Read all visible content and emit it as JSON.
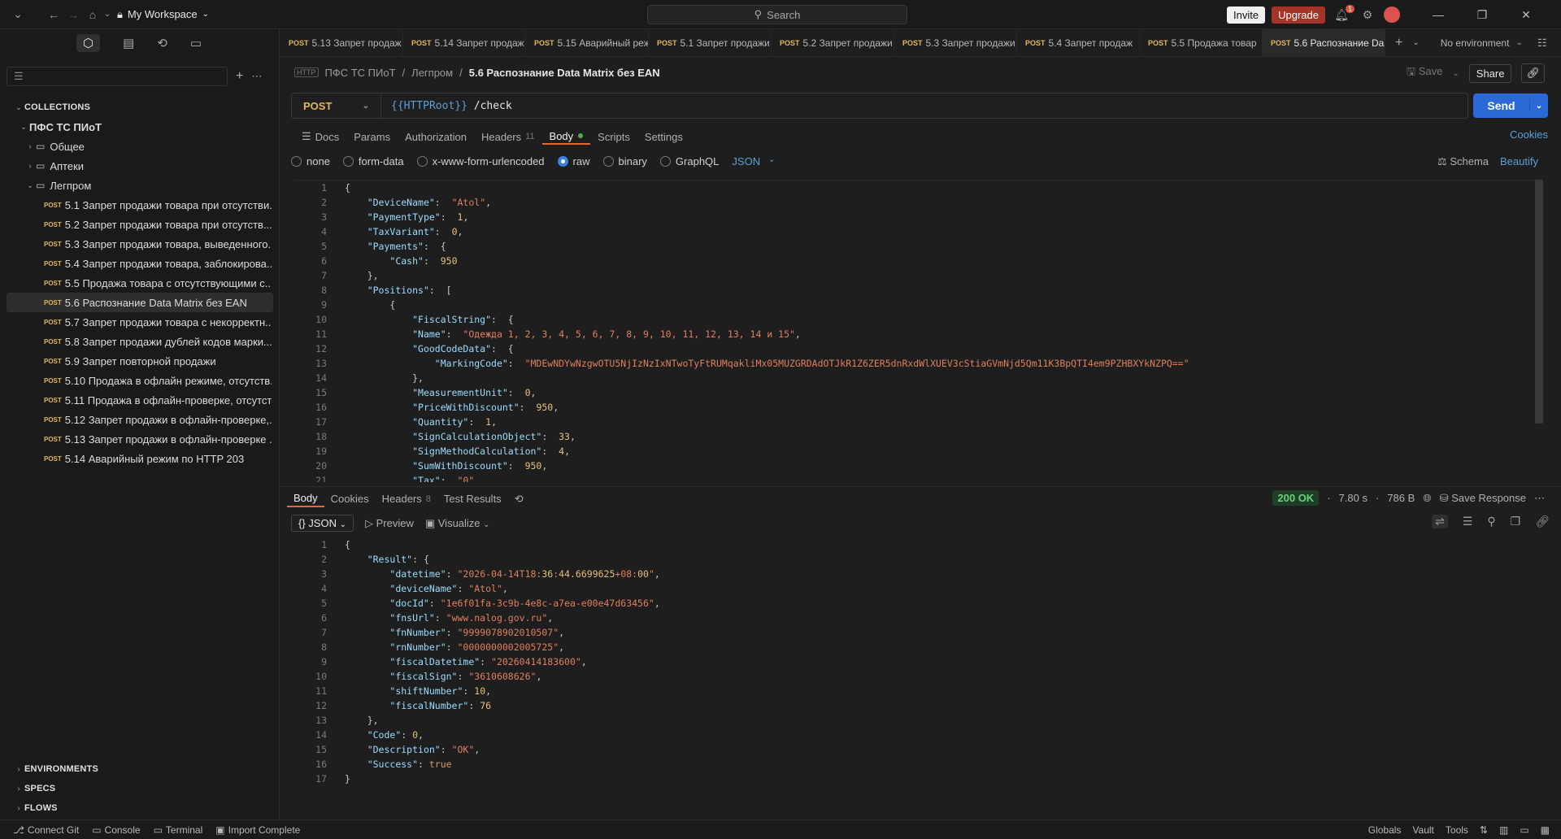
{
  "titlebar": {
    "workspace": "My Workspace",
    "search": "Search",
    "invite": "Invite",
    "upgrade": "Upgrade",
    "notif_count": "1"
  },
  "sidebar": {
    "collections_label": "COLLECTIONS",
    "root": "ПФС ТС ПИоТ",
    "folders": [
      "Общее",
      "Аптеки",
      "Легпром"
    ],
    "items": [
      "5.1 Запрет продажи товара при отсутстви...",
      "5.2 Запрет продажи товара при отсутств...",
      "5.3 Запрет продажи товара, выведенного...",
      "5.4 Запрет продажи товара, заблокирова...",
      "5.5 Продажа товара с отсутствующими с...",
      "5.6 Распознание Data Matrix без EAN",
      "5.7 Запрет продажи товара с некорректн...",
      "5.8 Запрет продажи дублей кодов марки...",
      "5.9 Запрет повторной продажи",
      "5.10 Продажа в офлайн режиме, отсутств...",
      "5.11 Продажа в офлайн-проверке, отсутст...",
      "5.12 Запрет продажи в офлайн-проверке,...",
      "5.13 Запрет продажи в офлайн-проверке ...",
      "5.14 Аварийный режим по HTTP 203"
    ],
    "post_tag": "POST",
    "environments": "ENVIRONMENTS",
    "specs": "SPECS",
    "flows": "FLOWS"
  },
  "tabs": [
    "5.13 Запрет продаж",
    "5.14 Запрет продаж",
    "5.15 Аварийный реж",
    "5.1 Запрет продажи",
    "5.2 Запрет продажи",
    "5.3 Запрет продажи",
    "5.4 Запрет продаж",
    "5.5 Продажа товар",
    "5.6 Распознание Da"
  ],
  "env": "No environment",
  "breadcrumb": {
    "root": "ПФС ТС ПИоТ",
    "folder": "Легпром",
    "current": "5.6 Распознание Data Matrix без EAN"
  },
  "save": "Save",
  "share": "Share",
  "request": {
    "method": "POST",
    "url_var": "{{HTTPRoot}}",
    "url_path": " /check",
    "send": "Send"
  },
  "reqtabs": {
    "docs": "Docs",
    "params": "Params",
    "auth": "Authorization",
    "headers": "Headers",
    "headers_count": "11",
    "body": "Body",
    "scripts": "Scripts",
    "settings": "Settings",
    "cookies": "Cookies"
  },
  "bodyopts": {
    "none": "none",
    "form": "form-data",
    "urlenc": "x-www-form-urlencoded",
    "raw": "raw",
    "binary": "binary",
    "graphql": "GraphQL",
    "json": "JSON",
    "schema": "Schema",
    "beautify": "Beautify"
  },
  "request_body": [
    "{",
    "    \"DeviceName\":  \"Atol\",",
    "    \"PaymentType\":  1,",
    "    \"TaxVariant\":  0,",
    "    \"Payments\":  {",
    "        \"Cash\":  950",
    "    },",
    "    \"Positions\":  [",
    "        {",
    "            \"FiscalString\":  {",
    "            \"Name\":  \"Одежда 1, 2, 3, 4, 5, 6, 7, 8, 9, 10, 11, 12, 13, 14 и 15\",",
    "            \"GoodCodeData\":  {",
    "                \"MarkingCode\":  \"MDEwNDYwNzgwOTU5NjIzNzIxNTwoTyFtRUMqakliMx05MUZGRDAdOTJkR1Z6ZER5dnRxdWlXUEV3cStiaGVmNjd5Qm11K3BpQTI4em9PZHBXYkNZPQ==\"",
    "            },",
    "            \"MeasurementUnit\":  0,",
    "            \"PriceWithDiscount\":  950,",
    "            \"Quantity\":  1,",
    "            \"SignCalculationObject\":  33,",
    "            \"SignMethodCalculation\":  4,",
    "            \"SumWithDiscount\":  950,",
    "            \"Tax\":  \"0\""
  ],
  "response": {
    "tabs": {
      "body": "Body",
      "cookies": "Cookies",
      "headers": "Headers",
      "headers_count": "8",
      "tests": "Test Results"
    },
    "status": "200 OK",
    "time": "7.80 s",
    "size": "786 B",
    "save": "Save Response",
    "format": "JSON",
    "preview": "Preview",
    "visualize": "Visualize",
    "body": [
      "{",
      "    \"Result\": {",
      "        \"datetime\": \"2026-04-14T18:36:44.6699625+08:00\",",
      "        \"deviceName\": \"Atol\",",
      "        \"docId\": \"1e6f01fa-3c9b-4e8c-a7ea-e00e47d63456\",",
      "        \"fnsUrl\": \"www.nalog.gov.ru\",",
      "        \"fnNumber\": \"9999078902010507\",",
      "        \"rnNumber\": \"0000000002005725\",",
      "        \"fiscalDatetime\": \"20260414183600\",",
      "        \"fiscalSign\": \"3610608626\",",
      "        \"shiftNumber\": 10,",
      "        \"fiscalNumber\": 76",
      "    },",
      "    \"Code\": 0,",
      "    \"Description\": \"OK\",",
      "    \"Success\": true",
      "}"
    ]
  },
  "footer": {
    "git": "Connect Git",
    "console": "Console",
    "terminal": "Terminal",
    "import": "Import Complete",
    "globals": "Globals",
    "vault": "Vault",
    "tools": "Tools"
  }
}
